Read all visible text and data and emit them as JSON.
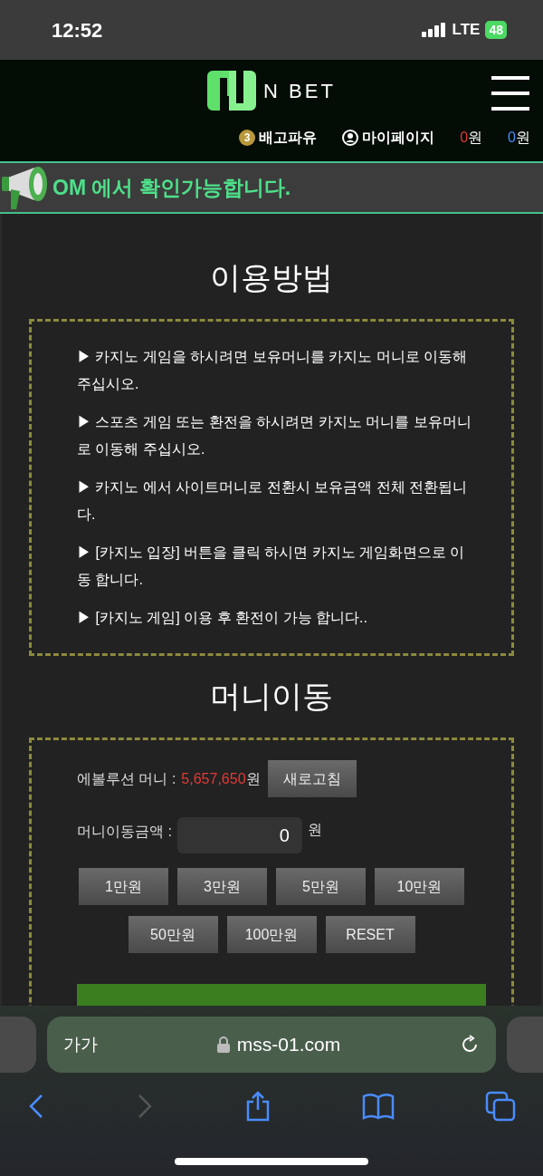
{
  "status_bar": {
    "time": "12:52",
    "network": "LTE",
    "battery": "48"
  },
  "header": {
    "logo_text": "N BET",
    "user": {
      "level": "3",
      "name": "배고파유"
    },
    "mypage": "마이페이지",
    "balances": [
      {
        "amount": "0",
        "unit": "원",
        "color": "#e53935"
      },
      {
        "amount": "0",
        "unit": "원",
        "color": "#4a8cff"
      }
    ]
  },
  "notice": "OM 에서 확인가능합니다.",
  "guide": {
    "title": "이용방법",
    "items": [
      "▶ 카지노 게임을 하시려면 보유머니를 카지노 머니로 이동해 주십시오.",
      "▶ 스포츠 게임 또는 환전을 하시려면 카지노 머니를 보유머니로 이동해 주십시오.",
      "▶ 카지노 에서 사이트머니로 전환시 보유금액 전체 전환됩니다.",
      "▶ [카지노 입장] 버튼을 클릭 하시면 카지노 게임화면으로 이동 합니다.",
      "▶ [카지노 게임] 이용 후 환전이 가능 합니다.."
    ]
  },
  "transfer": {
    "title": "머니이동",
    "balance_label": "에볼루션 머니 :",
    "balance": "5,657,650",
    "balance_unit": "원",
    "refresh": "새로고침",
    "amount_label": "머니이동금액 :",
    "amount": "0",
    "amount_unit": "원",
    "quick_rows": [
      [
        "1만원",
        "3만원",
        "5만원",
        "10만원"
      ],
      [
        "50만원",
        "100만원",
        "RESET"
      ]
    ]
  },
  "browser": {
    "text_size": "가가",
    "url": "mss-01.com"
  }
}
